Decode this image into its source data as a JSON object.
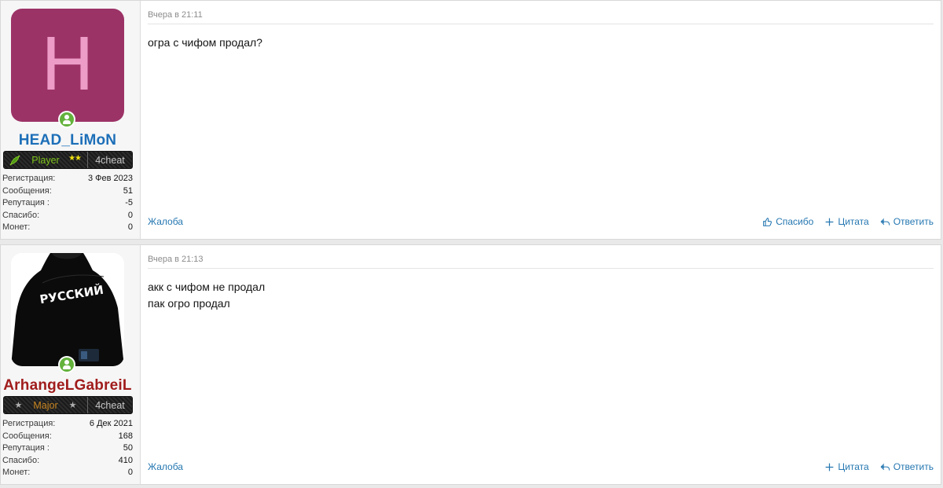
{
  "posts": [
    {
      "avatar_letter": "H",
      "username": "HEAD_LiMoN",
      "rank": "Player",
      "rank_stars": "★★",
      "forum_tag": "4cheat",
      "stats": [
        {
          "label": "Регистрация:",
          "value": "3 Фев 2023"
        },
        {
          "label": "Сообщения:",
          "value": "51"
        },
        {
          "label": "Репутация :",
          "value": "-5"
        },
        {
          "label": "Спасибо:",
          "value": "0"
        },
        {
          "label": "Монет:",
          "value": "0"
        }
      ],
      "date": "Вчера в 21:11",
      "body": [
        "огра с чифом продал?"
      ],
      "report_label": "Жалоба",
      "thanks_label": "Спасибо",
      "quote_label": "Цитата",
      "reply_label": "Ответить"
    },
    {
      "avatar_text": "РУССКИЙ",
      "username": "ArhangeLGabreiL",
      "rank": "Major",
      "rank_star": "★",
      "forum_tag": "4cheat",
      "stats": [
        {
          "label": "Регистрация:",
          "value": "6 Дек 2021"
        },
        {
          "label": "Сообщения:",
          "value": "168"
        },
        {
          "label": "Репутация :",
          "value": "50"
        },
        {
          "label": "Спасибо:",
          "value": "410"
        },
        {
          "label": "Монет:",
          "value": "0"
        }
      ],
      "date": "Вчера в 21:13",
      "body": [
        "акк с чифом не продал",
        "пак огро продал"
      ],
      "report_label": "Жалоба",
      "quote_label": "Цитата",
      "reply_label": "Ответить"
    }
  ],
  "colors": {
    "link": "#2577b1",
    "username_1": "#1d6fb8",
    "username_2": "#a01c1c",
    "avatar_bg": "#9c3367",
    "online": "#63b23c"
  }
}
